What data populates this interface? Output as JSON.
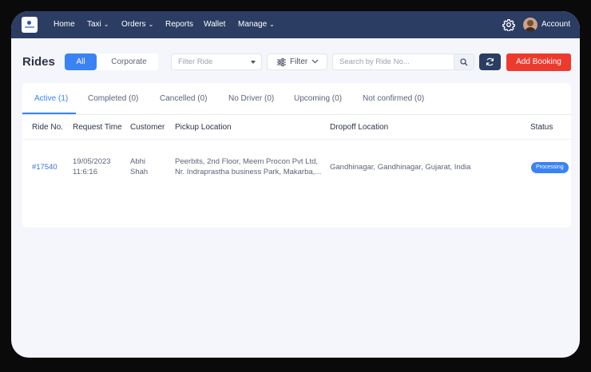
{
  "nav": {
    "items": [
      {
        "label": "Home",
        "caret": false
      },
      {
        "label": "Taxi",
        "caret": true
      },
      {
        "label": "Orders",
        "caret": true
      },
      {
        "label": "Reports",
        "caret": false
      },
      {
        "label": "Wallet",
        "caret": false
      },
      {
        "label": "Manage",
        "caret": true
      }
    ],
    "account_label": "Account",
    "bg_color": "#2b3d63"
  },
  "page": {
    "title": "Rides",
    "segment": {
      "all": "All",
      "corporate": "Corporate",
      "active": "All"
    },
    "filter_ride_placeholder": "Filter Ride",
    "filter_button": "Filter",
    "search_placeholder": "Search by Ride No...",
    "add_booking": "Add Booking",
    "accent_color": "#3b82f6",
    "add_color": "#ee3a2e"
  },
  "tabs": [
    {
      "label": "Active (1)",
      "active": true
    },
    {
      "label": "Completed (0)",
      "active": false
    },
    {
      "label": "Cancelled (0)",
      "active": false
    },
    {
      "label": "No Driver (0)",
      "active": false
    },
    {
      "label": "Upcoming (0)",
      "active": false
    },
    {
      "label": "Not confirmed (0)",
      "active": false
    }
  ],
  "table": {
    "columns": [
      "Ride No.",
      "Request Time",
      "Customer",
      "Pickup Location",
      "Dropoff Location",
      "Status"
    ],
    "rows": [
      {
        "ride_no": "#17540",
        "date": "19/05/2023",
        "time": "11:6:16",
        "customer_first": "Abhi",
        "customer_last": "Shah",
        "pickup_line1": "Peerbits, 2nd Floor, Meem Procon Pvt Ltd,",
        "pickup_line2": "Nr. Indraprastha business Park, Makarba,...",
        "dropoff": "Gandhinagar, Gandhinagar, Gujarat, India",
        "status": "Processing"
      }
    ]
  }
}
